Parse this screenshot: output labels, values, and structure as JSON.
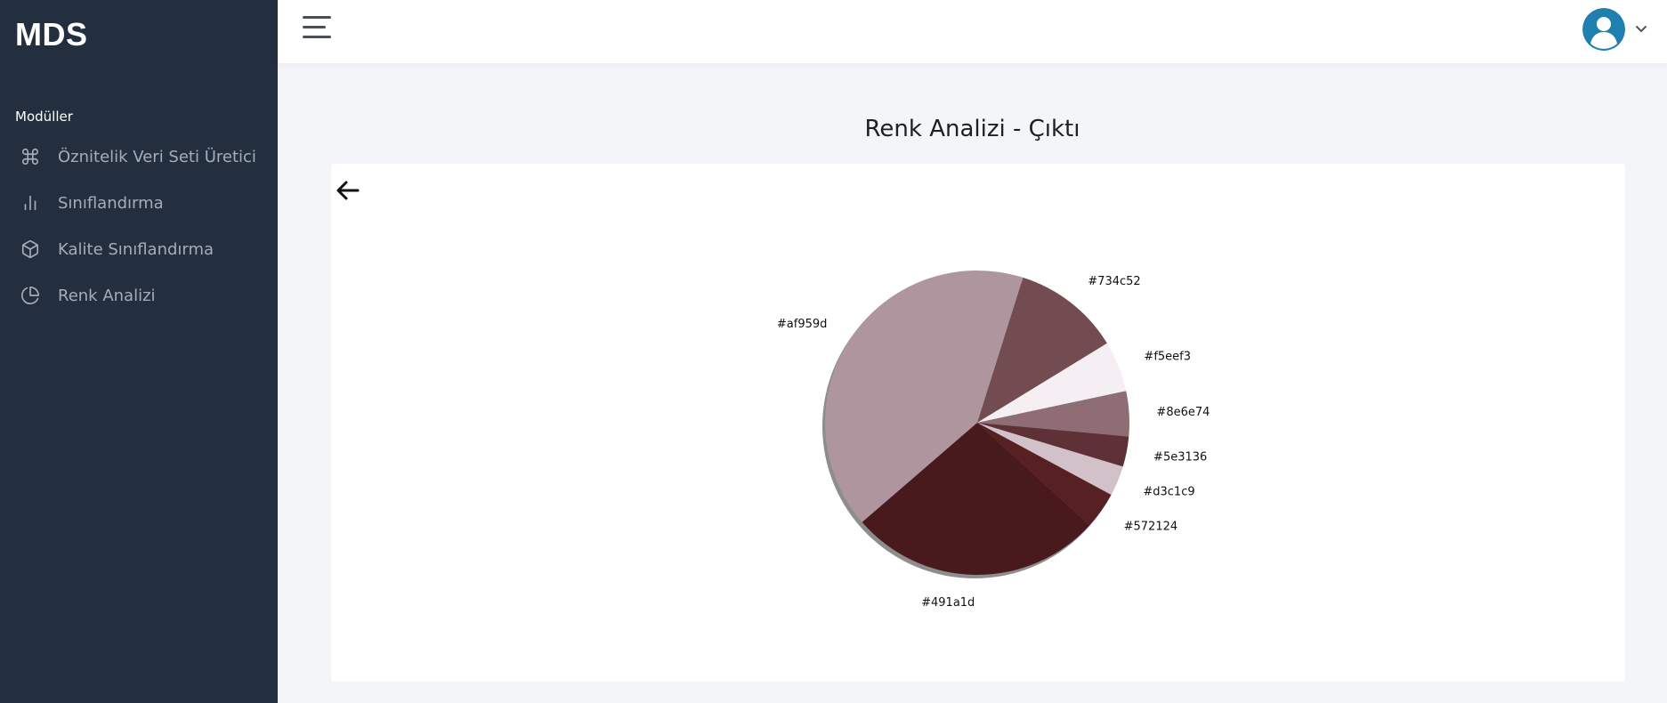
{
  "sidebar": {
    "brand": "MDS",
    "section_label": "Modüller",
    "items": [
      {
        "label": "Öznitelik Veri Seti Üretici",
        "icon": "command-icon"
      },
      {
        "label": "Sınıflandırma",
        "icon": "bar-chart-icon"
      },
      {
        "label": "Kalite Sınıflandırma",
        "icon": "box-icon"
      },
      {
        "label": "Renk Analizi",
        "icon": "pie-chart-icon"
      }
    ]
  },
  "topbar": {
    "menu_icon": "hamburger-menu-icon",
    "user_icon": "user-avatar-icon",
    "dropdown_icon": "chevron-down-icon",
    "avatar_color": "#1f7fae"
  },
  "page": {
    "title": "Renk Analizi - Çıktı",
    "back_icon": "arrow-left-icon"
  },
  "chart_data": {
    "type": "pie",
    "title": "",
    "slices": [
      {
        "label": "#734c52",
        "color": "#734c52",
        "value": 11.4
      },
      {
        "label": "#f5eef3",
        "color": "#f5eef3",
        "value": 5.4
      },
      {
        "label": "#8e6e74",
        "color": "#8e6e74",
        "value": 4.8
      },
      {
        "label": "#5e3136",
        "color": "#5e3136",
        "value": 3.2
      },
      {
        "label": "#d3c1c9",
        "color": "#d3c1c9",
        "value": 3.2
      },
      {
        "label": "#572124",
        "color": "#572124",
        "value": 3.9
      },
      {
        "label": "#491a1d",
        "color": "#491a1d",
        "value": 26.9
      },
      {
        "label": "#af959d",
        "color": "#af959d",
        "value": 41.2
      }
    ],
    "shadow": true,
    "legend": "none"
  }
}
